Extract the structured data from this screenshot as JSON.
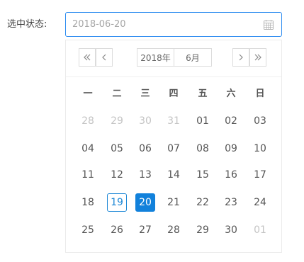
{
  "form": {
    "label": "选中状态:",
    "value": "2018-06-20",
    "icon": "calendar-icon"
  },
  "calendar": {
    "year_label": "2018年",
    "month_label": "6月",
    "nav_icons": [
      "double-chevron-left-icon",
      "chevron-left-icon",
      "chevron-right-icon",
      "double-chevron-right-icon"
    ],
    "weekdays": [
      "一",
      "二",
      "三",
      "四",
      "五",
      "六",
      "日"
    ],
    "weeks": [
      [
        {
          "d": "28",
          "other": true
        },
        {
          "d": "29",
          "other": true
        },
        {
          "d": "30",
          "other": true
        },
        {
          "d": "31",
          "other": true
        },
        {
          "d": "01"
        },
        {
          "d": "02"
        },
        {
          "d": "03"
        }
      ],
      [
        {
          "d": "04"
        },
        {
          "d": "05"
        },
        {
          "d": "06"
        },
        {
          "d": "07"
        },
        {
          "d": "08"
        },
        {
          "d": "09"
        },
        {
          "d": "10"
        }
      ],
      [
        {
          "d": "11"
        },
        {
          "d": "12"
        },
        {
          "d": "13"
        },
        {
          "d": "14"
        },
        {
          "d": "15"
        },
        {
          "d": "16"
        },
        {
          "d": "17"
        }
      ],
      [
        {
          "d": "18"
        },
        {
          "d": "19",
          "today": true
        },
        {
          "d": "20",
          "selected": true
        },
        {
          "d": "21"
        },
        {
          "d": "22"
        },
        {
          "d": "23"
        },
        {
          "d": "24"
        }
      ],
      [
        {
          "d": "25"
        },
        {
          "d": "26"
        },
        {
          "d": "27"
        },
        {
          "d": "28"
        },
        {
          "d": "29"
        },
        {
          "d": "30"
        },
        {
          "d": "01",
          "other": true
        }
      ]
    ],
    "colors": {
      "accent": "#1281db",
      "focus_border": "#2d8cf0",
      "muted_day": "#c4c4c4"
    }
  }
}
